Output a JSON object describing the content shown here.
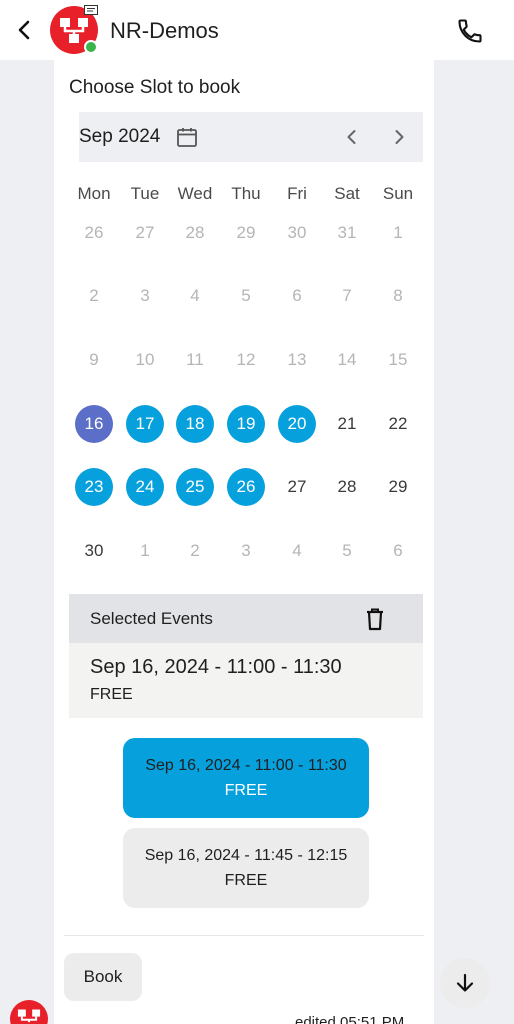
{
  "header": {
    "title": "NR-Demos",
    "back_icon": "chevron-left-icon",
    "call_icon": "phone-icon",
    "status_color": "#3bb54a"
  },
  "booking": {
    "title": "Choose Slot to book",
    "month_label": "Sep 2024",
    "weekdays": [
      "Mon",
      "Tue",
      "Wed",
      "Thu",
      "Fri",
      "Sat",
      "Sun"
    ],
    "weeks": [
      [
        {
          "d": "26",
          "s": "muted"
        },
        {
          "d": "27",
          "s": "muted"
        },
        {
          "d": "28",
          "s": "muted"
        },
        {
          "d": "29",
          "s": "muted"
        },
        {
          "d": "30",
          "s": "muted"
        },
        {
          "d": "31",
          "s": "muted"
        },
        {
          "d": "1",
          "s": "muted"
        }
      ],
      [
        {
          "d": "2",
          "s": "muted"
        },
        {
          "d": "3",
          "s": "muted"
        },
        {
          "d": "4",
          "s": "muted"
        },
        {
          "d": "5",
          "s": "muted"
        },
        {
          "d": "6",
          "s": "muted"
        },
        {
          "d": "7",
          "s": "muted"
        },
        {
          "d": "8",
          "s": "muted"
        }
      ],
      [
        {
          "d": "9",
          "s": "muted"
        },
        {
          "d": "10",
          "s": "muted"
        },
        {
          "d": "11",
          "s": "muted"
        },
        {
          "d": "12",
          "s": "muted"
        },
        {
          "d": "13",
          "s": "muted"
        },
        {
          "d": "14",
          "s": "muted"
        },
        {
          "d": "15",
          "s": "muted"
        }
      ],
      [
        {
          "d": "16",
          "s": "selected"
        },
        {
          "d": "17",
          "s": "avail"
        },
        {
          "d": "18",
          "s": "avail"
        },
        {
          "d": "19",
          "s": "avail"
        },
        {
          "d": "20",
          "s": "avail"
        },
        {
          "d": "21",
          "s": "normal"
        },
        {
          "d": "22",
          "s": "normal"
        }
      ],
      [
        {
          "d": "23",
          "s": "avail"
        },
        {
          "d": "24",
          "s": "avail"
        },
        {
          "d": "25",
          "s": "avail"
        },
        {
          "d": "26",
          "s": "avail"
        },
        {
          "d": "27",
          "s": "normal"
        },
        {
          "d": "28",
          "s": "normal"
        },
        {
          "d": "29",
          "s": "normal"
        }
      ],
      [
        {
          "d": "30",
          "s": "normal"
        },
        {
          "d": "1",
          "s": "muted"
        },
        {
          "d": "2",
          "s": "muted"
        },
        {
          "d": "3",
          "s": "muted"
        },
        {
          "d": "4",
          "s": "muted"
        },
        {
          "d": "5",
          "s": "muted"
        },
        {
          "d": "6",
          "s": "muted"
        }
      ]
    ],
    "selected_events_label": "Selected Events",
    "selected_event": {
      "date": "Sep 16, 2024 - 11:00 - 11:30",
      "status": "FREE"
    },
    "slots": [
      {
        "date": "Sep 16, 2024 - 11:00 - 11:30",
        "status": "FREE",
        "active": true
      },
      {
        "date": "Sep 16, 2024 - 11:45 - 12:15",
        "status": "FREE",
        "active": false
      }
    ],
    "book_label": "Book",
    "edited_label": "edited 05:51 PM"
  },
  "colors": {
    "accent": "#06a0dd",
    "selected_day": "#5b6ec8",
    "avatar_red": "#e8202a"
  }
}
